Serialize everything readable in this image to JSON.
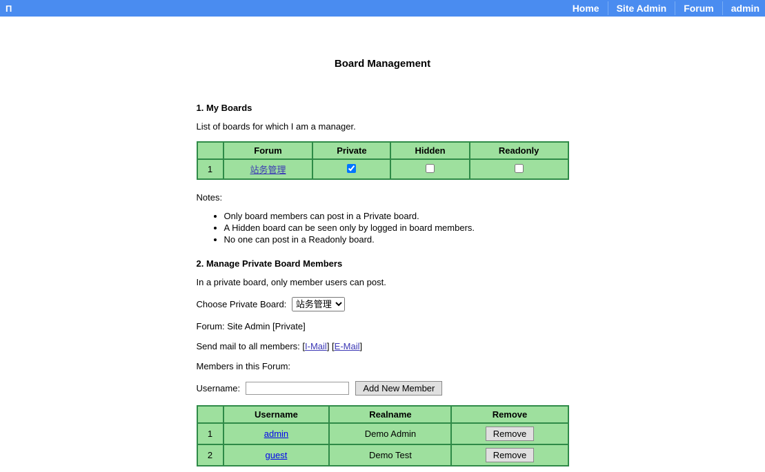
{
  "navbar": {
    "brand": "П",
    "links": [
      "Home",
      "Site Admin",
      "Forum",
      "admin"
    ]
  },
  "page_title": "Board Management",
  "section1": {
    "title": "1. My Boards",
    "description": "List of boards for which I am a manager.",
    "headers": [
      "Forum",
      "Private",
      "Hidden",
      "Readonly"
    ],
    "rows": [
      {
        "num": "1",
        "forum": "站务管理",
        "private": true,
        "hidden": false,
        "readonly": false
      }
    ],
    "notes_label": "Notes:",
    "notes": [
      "Only board members can post in a Private board.",
      "A Hidden board can be seen only by logged in board members.",
      "No one can post in a Readonly board."
    ]
  },
  "section2": {
    "title": "2. Manage Private Board Members",
    "description": "In a private board, only member users can post.",
    "choose_label": "Choose Private Board:",
    "select_value": "站务管理",
    "forum_line": "Forum: Site Admin [Private]",
    "mail_label": "Send mail to all members: ",
    "mail_imail": "I-Mail",
    "mail_email": "E-Mail",
    "members_label": "Members in this Forum:",
    "username_label": "Username:",
    "add_button": "Add New Member",
    "members_headers": [
      "Username",
      "Realname",
      "Remove"
    ],
    "members": [
      {
        "num": "1",
        "username": "admin",
        "realname": "Demo Admin",
        "remove": "Remove"
      },
      {
        "num": "2",
        "username": "guest",
        "realname": "Demo Test",
        "remove": "Remove"
      }
    ]
  }
}
